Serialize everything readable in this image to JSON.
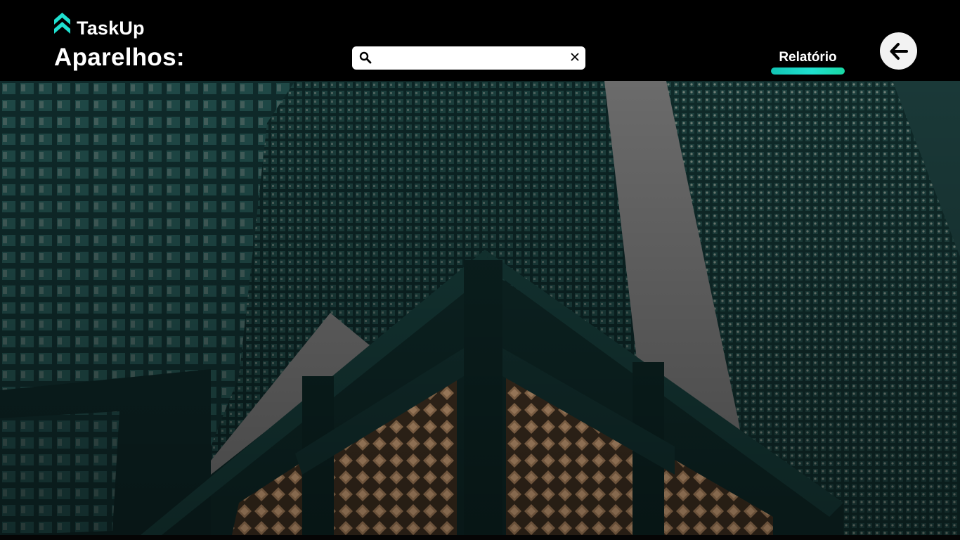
{
  "app": {
    "name": "TaskUp",
    "brand_color": "#1fe0cf"
  },
  "header": {
    "page_title": "Aparelhos:",
    "search": {
      "value": "",
      "placeholder": ""
    },
    "nav": {
      "report_label": "Relatório"
    },
    "icons": {
      "logo": "chevron-up-double-icon",
      "search": "search-icon",
      "clear": "close-icon",
      "back": "arrow-left-icon"
    }
  },
  "hero": {
    "image": "dark-teal-skyscrapers-photo"
  }
}
